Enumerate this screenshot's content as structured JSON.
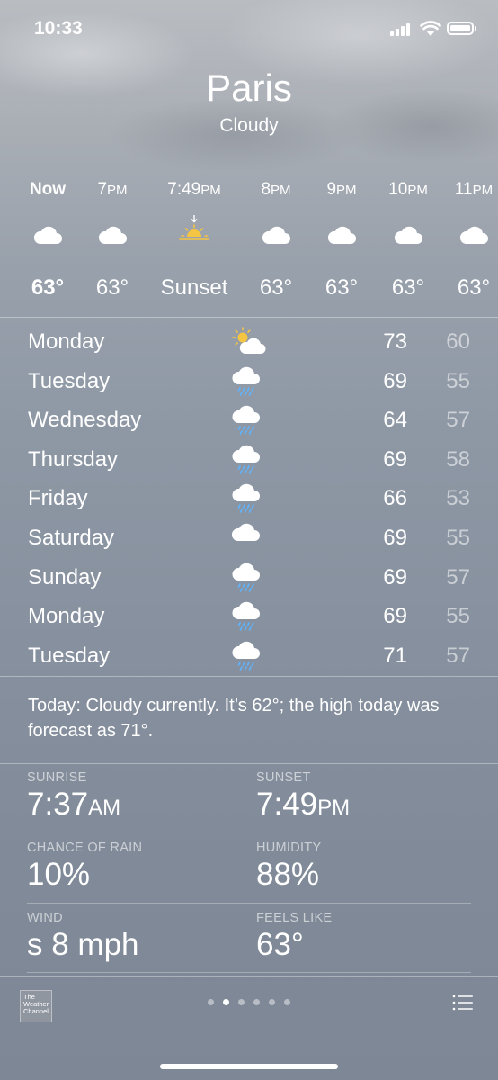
{
  "status_bar": {
    "time": "10:33"
  },
  "location": {
    "city": "Paris",
    "condition": "Cloudy"
  },
  "hourly": [
    {
      "label": "Now",
      "small": "",
      "icon": "cloud-icon",
      "temp": "63°",
      "bold": true
    },
    {
      "label": "7",
      "small": "PM",
      "icon": "cloud-icon",
      "temp": "63°"
    },
    {
      "label": "7:49",
      "small": "PM",
      "icon": "sunset-icon",
      "temp": "Sunset"
    },
    {
      "label": "8",
      "small": "PM",
      "icon": "cloud-icon",
      "temp": "63°"
    },
    {
      "label": "9",
      "small": "PM",
      "icon": "cloud-icon",
      "temp": "63°"
    },
    {
      "label": "10",
      "small": "PM",
      "icon": "cloud-icon",
      "temp": "63°"
    },
    {
      "label": "11",
      "small": "PM",
      "icon": "cloud-icon",
      "temp": "63°"
    }
  ],
  "daily": [
    {
      "day": "Monday",
      "icon": "partly-sunny-icon",
      "high": "73",
      "low": "60"
    },
    {
      "day": "Tuesday",
      "icon": "rain-cloud-icon",
      "high": "69",
      "low": "55"
    },
    {
      "day": "Wednesday",
      "icon": "rain-cloud-icon",
      "high": "64",
      "low": "57"
    },
    {
      "day": "Thursday",
      "icon": "rain-cloud-icon",
      "high": "69",
      "low": "58"
    },
    {
      "day": "Friday",
      "icon": "rain-cloud-icon",
      "high": "66",
      "low": "53"
    },
    {
      "day": "Saturday",
      "icon": "cloud-icon",
      "high": "69",
      "low": "55"
    },
    {
      "day": "Sunday",
      "icon": "rain-cloud-icon",
      "high": "69",
      "low": "57"
    },
    {
      "day": "Monday",
      "icon": "rain-cloud-icon",
      "high": "69",
      "low": "55"
    },
    {
      "day": "Tuesday",
      "icon": "rain-cloud-icon",
      "high": "71",
      "low": "57"
    }
  ],
  "summary": "Today: Cloudy currently. It’s 62°; the high today was forecast as 71°.",
  "details": {
    "sunrise_label": "SUNRISE",
    "sunrise_value": "7:37",
    "sunrise_suffix": "AM",
    "sunset_label": "SUNSET",
    "sunset_value": "7:49",
    "sunset_suffix": "PM",
    "rain_label": "CHANCE OF RAIN",
    "rain_value": "10%",
    "humidity_label": "HUMIDITY",
    "humidity_value": "88%",
    "wind_label": "WIND",
    "wind_value": "s 8 mph",
    "feels_label": "FEELS LIKE",
    "feels_value": "63°"
  },
  "footer": {
    "logo_text": "The Weather Channel",
    "page_count": 6,
    "active_page": 2
  },
  "colors": {
    "background_top": "#b9bcc1",
    "background_bottom": "#7d8795",
    "text": "#ffffff",
    "muted_text": "rgba(255,255,255,0.55)",
    "sun": "#f4c542"
  }
}
